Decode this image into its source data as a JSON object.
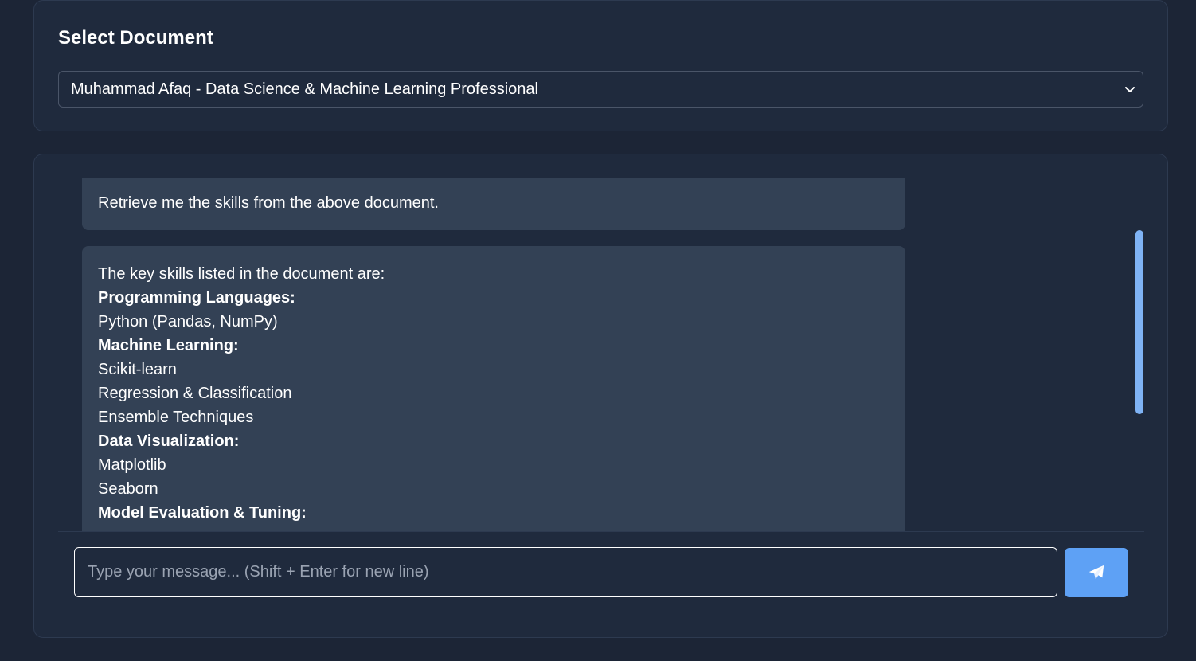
{
  "document_selector": {
    "title": "Select Document",
    "selected_value": "Muhammad Afaq - Data Science & Machine Learning Professional",
    "icon": "chevron-down-icon"
  },
  "chat": {
    "messages": [
      {
        "role": "user",
        "text": "Retrieve me the skills from the above document."
      },
      {
        "role": "assistant",
        "lines": [
          {
            "text": "The key skills listed in the document are:",
            "bold": false
          },
          {
            "text": "Programming Languages:",
            "bold": true
          },
          {
            "text": "Python (Pandas, NumPy)",
            "bold": false
          },
          {
            "text": "Machine Learning:",
            "bold": true
          },
          {
            "text": "Scikit-learn",
            "bold": false
          },
          {
            "text": "Regression & Classification",
            "bold": false
          },
          {
            "text": "Ensemble Techniques",
            "bold": false
          },
          {
            "text": "Data Visualization:",
            "bold": true
          },
          {
            "text": "Matplotlib",
            "bold": false
          },
          {
            "text": "Seaborn",
            "bold": false
          },
          {
            "text": "Model Evaluation & Tuning:",
            "bold": true
          }
        ]
      }
    ],
    "input": {
      "placeholder": "Type your message... (Shift + Enter for new line)",
      "value": ""
    },
    "send_button": {
      "icon": "paper-plane-icon"
    }
  },
  "colors": {
    "page_bg": "#1c2536",
    "card_bg": "#1f2a3d",
    "message_bg": "#334155",
    "accent": "#5ea1f5",
    "scrollbar": "#7fb3f5"
  }
}
